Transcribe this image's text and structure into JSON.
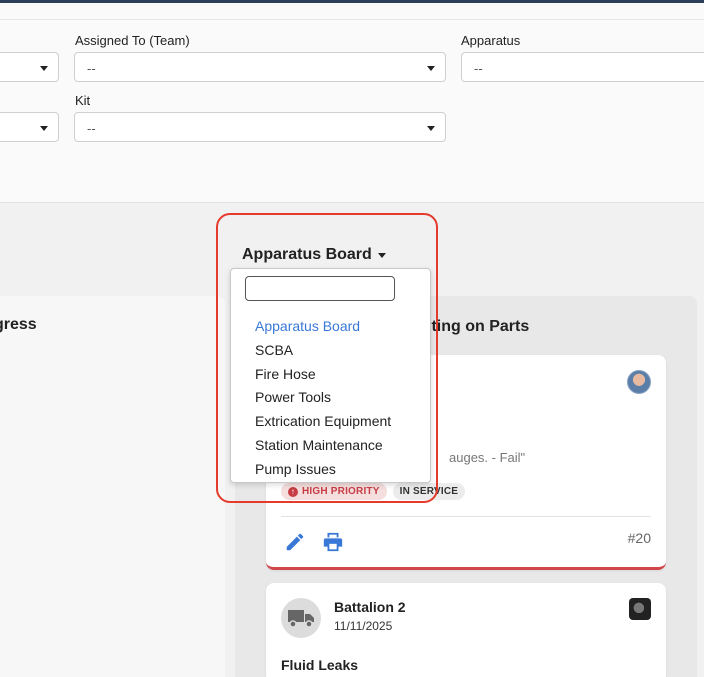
{
  "filters": {
    "assigned_label": "Assigned To (Team)",
    "assigned_value": "--",
    "apparatus_label": "Apparatus",
    "apparatus_value": "--",
    "kit_label": "Kit",
    "kit_value": "--"
  },
  "board": {
    "toggle_label": "Apparatus Board",
    "search_placeholder": "",
    "options": [
      "Apparatus Board",
      "SCBA",
      "Fire Hose",
      "Power Tools",
      "Extrication Equipment",
      "Station Maintenance",
      "Pump Issues"
    ],
    "selected": "Apparatus Board"
  },
  "columns": {
    "left_title_partial": "gress",
    "right_title_partial": "iting on Parts"
  },
  "card1": {
    "text_partial": "auges. - Fail\"",
    "badge_priority": "HIGH PRIORITY",
    "badge_status": "IN SERVICE",
    "number": "#20"
  },
  "card2": {
    "title": "Battalion 2",
    "date": "11/11/2025",
    "issue": "Fluid Leaks"
  },
  "colors": {
    "accent": "#3a78d8",
    "priority": "#c63d44",
    "highlight": "#e53b2c"
  }
}
